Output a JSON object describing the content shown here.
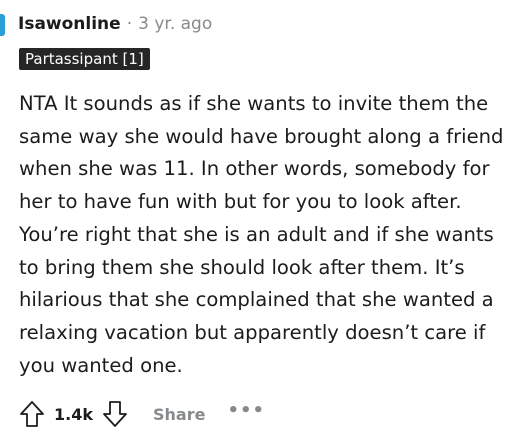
{
  "comment": {
    "author": "Isawonline",
    "separator": "·",
    "age": "3 yr. ago",
    "flair": "Partassipant [1]",
    "body": "NTA It sounds as if she wants to invite them the same way she would have brought along a friend when she was 11. In other words, somebody for her to have fun with but for you to look after. You’re right that she is an adult and if she wants to bring them she should look after them. It’s hilarious that she complained that she wanted a relaxing vacation but apparently doesn’t care if you wanted one."
  },
  "actions": {
    "upvote_icon": "arrow-up-outline-icon",
    "score": "1.4k",
    "downvote_icon": "arrow-down-outline-icon",
    "share_label": "Share",
    "more_label": "•••"
  },
  "colors": {
    "text": "#1c1c1c",
    "muted": "#878a8c",
    "flair_bg": "#262626",
    "flair_text": "#ffffff",
    "rail": "#2a9fd6"
  }
}
